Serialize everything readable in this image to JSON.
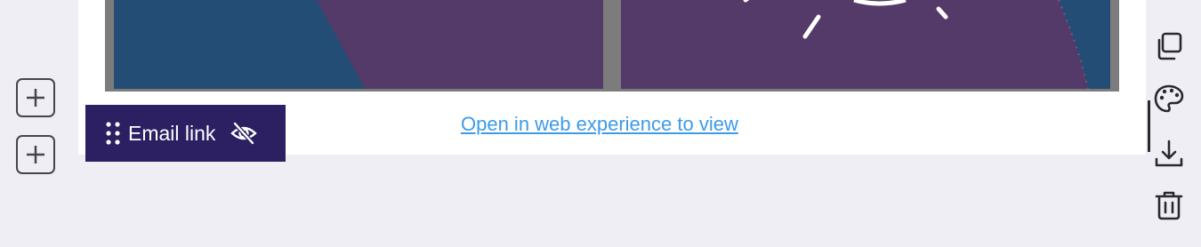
{
  "editor": {
    "web_link_text": "Open in web experience to view",
    "selected_element": {
      "label": "Email link",
      "visibility": "hidden"
    },
    "toolbar": {
      "duplicate_icon": "duplicate-icon",
      "style_icon": "palette-icon",
      "save_icon": "download-icon",
      "delete_icon": "trash-icon"
    },
    "colors": {
      "background": "#efeef4",
      "tag_background": "#2c2063",
      "link": "#3d9be9",
      "image_blue": "#234d74",
      "image_purple": "#543a68"
    }
  }
}
